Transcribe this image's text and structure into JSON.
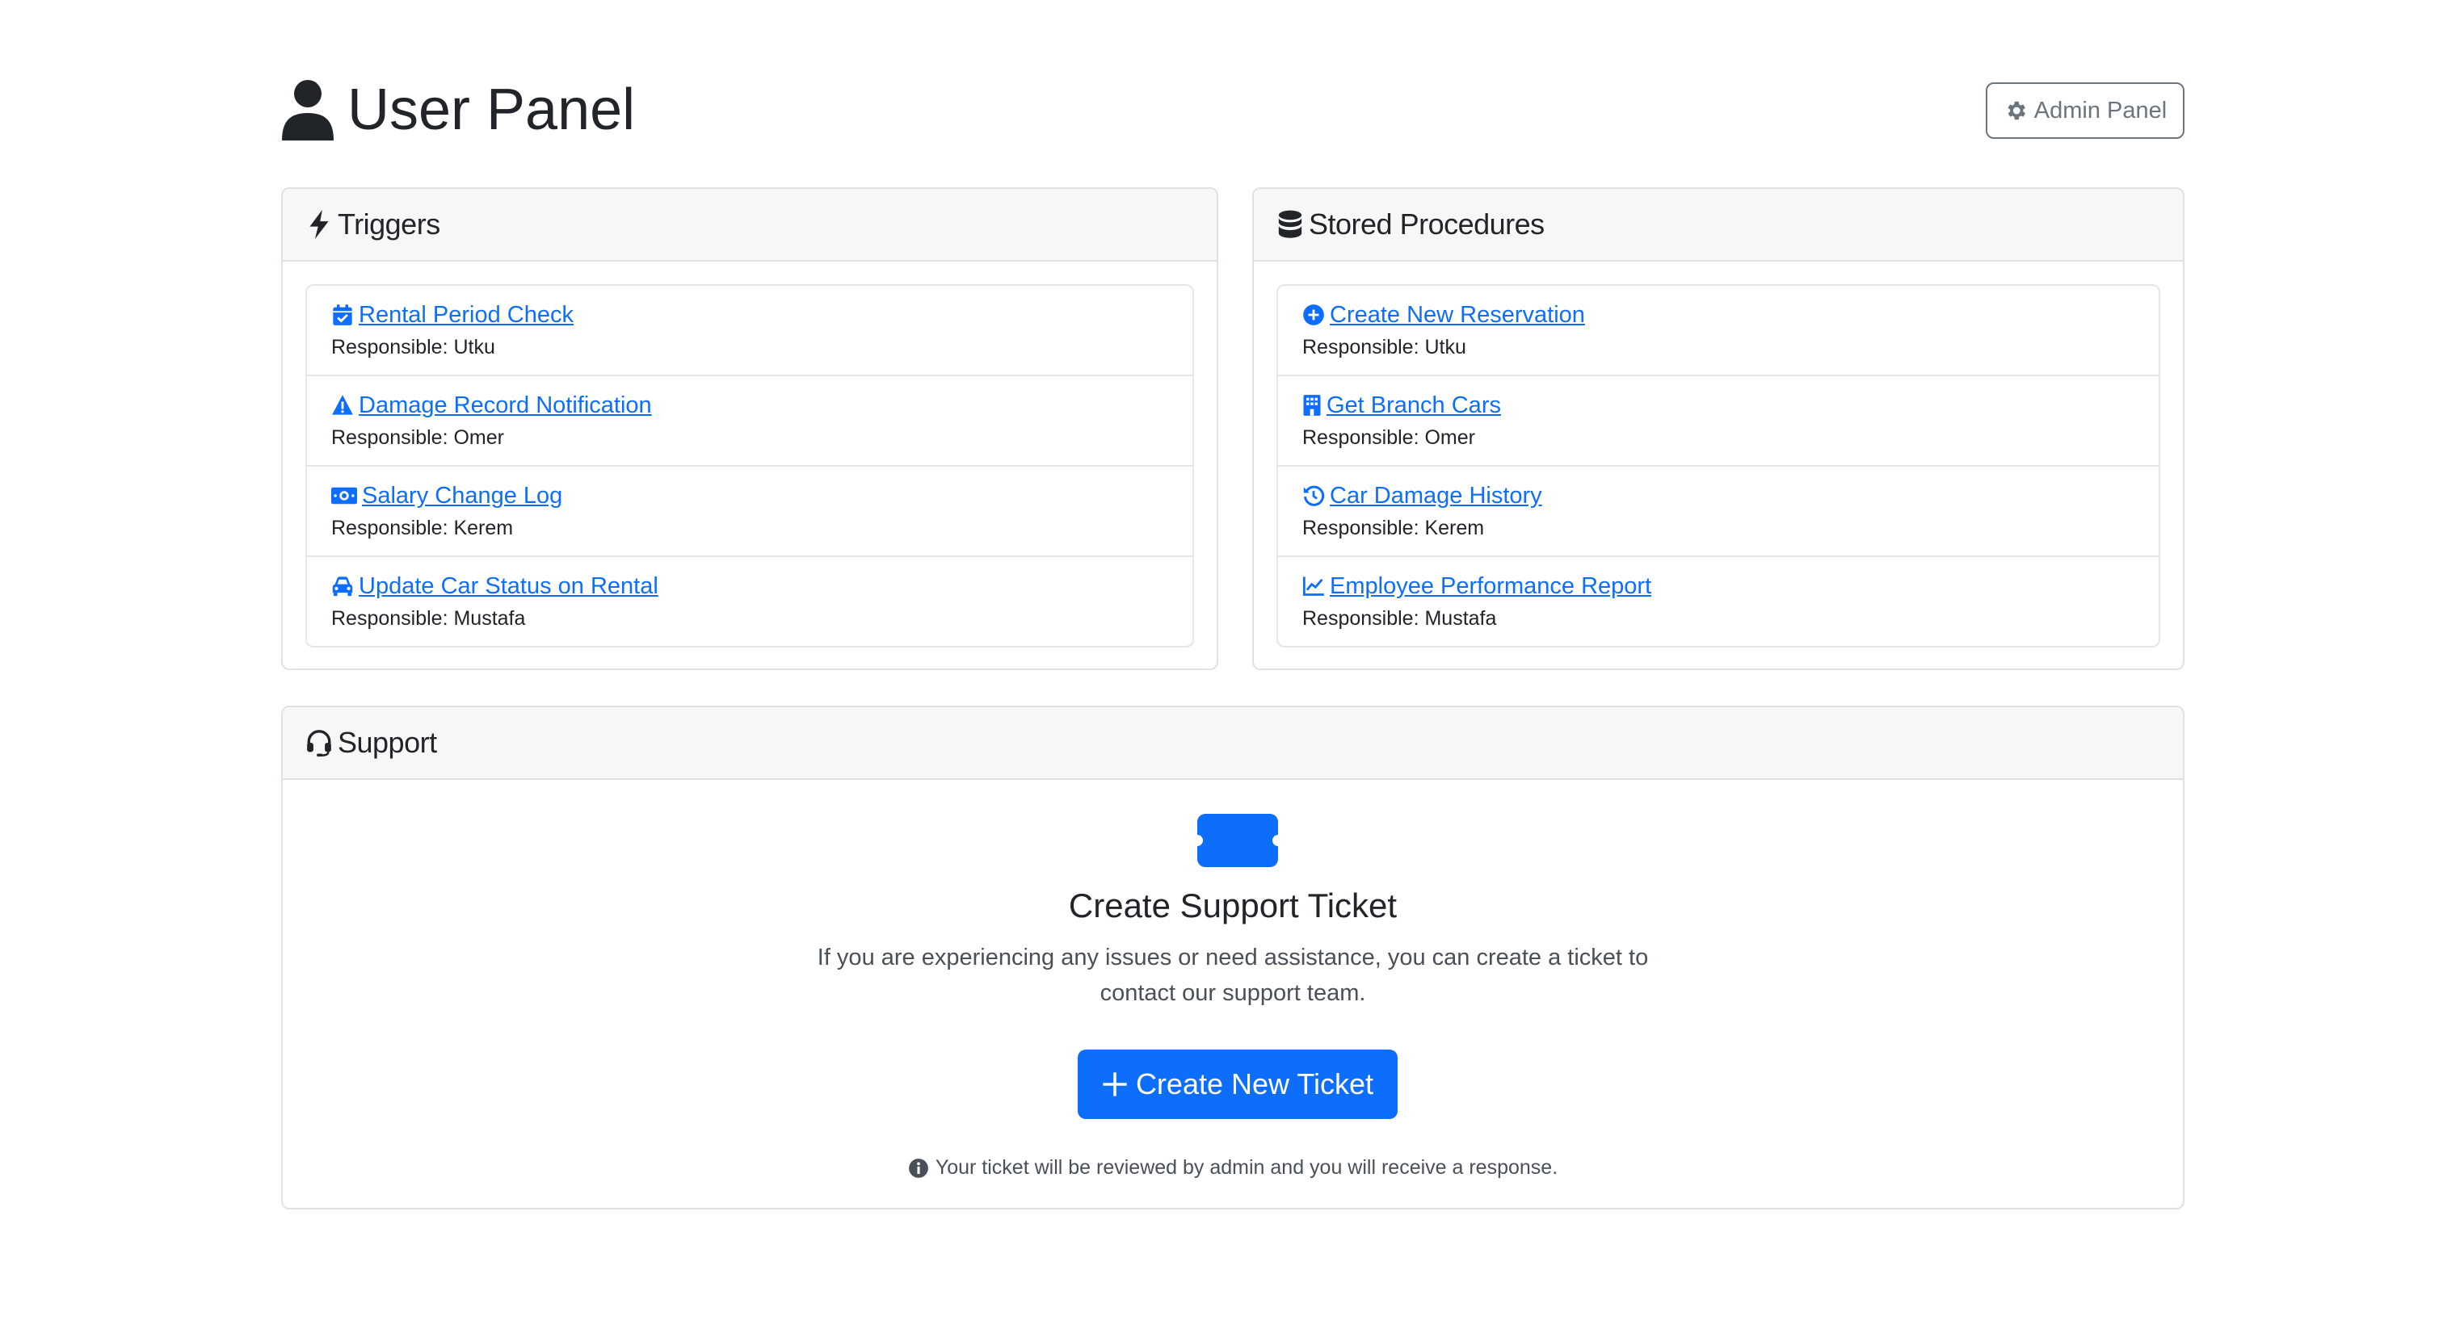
{
  "header": {
    "title": "User Panel",
    "title_icon": "user-icon",
    "admin_button": "Admin Panel"
  },
  "triggers": {
    "title": "Triggers",
    "icon": "bolt-icon",
    "items": [
      {
        "label": "Rental Period Check",
        "responsible": "Responsible: Utku",
        "icon": "calendar-check-icon"
      },
      {
        "label": "Damage Record Notification",
        "responsible": "Responsible: Omer",
        "icon": "warning-icon"
      },
      {
        "label": "Salary Change Log",
        "responsible": "Responsible: Kerem",
        "icon": "money-icon"
      },
      {
        "label": "Update Car Status on Rental",
        "responsible": "Responsible: Mustafa",
        "icon": "car-icon"
      }
    ]
  },
  "procedures": {
    "title": "Stored Procedures",
    "icon": "database-icon",
    "items": [
      {
        "label": "Create New Reservation",
        "responsible": "Responsible: Utku",
        "icon": "plus-circle-icon"
      },
      {
        "label": "Get Branch Cars",
        "responsible": "Responsible: Omer",
        "icon": "building-icon"
      },
      {
        "label": "Car Damage History",
        "responsible": "Responsible: Kerem",
        "icon": "history-icon"
      },
      {
        "label": "Employee Performance Report",
        "responsible": "Responsible: Mustafa",
        "icon": "chart-line-icon"
      }
    ]
  },
  "support": {
    "title": "Support",
    "icon": "headset-icon",
    "ticket_icon": "ticket-icon",
    "heading": "Create Support Ticket",
    "description": "If you are experiencing any issues or need assistance, you can create a ticket to contact our support team.",
    "button": "Create New Ticket",
    "note": "Your ticket will be reviewed by admin and you will receive a response."
  },
  "colors": {
    "primary": "#0d6efd",
    "secondary": "#6c757d",
    "card_header_bg": "#f7f7f7",
    "border": "#dee2e6"
  }
}
